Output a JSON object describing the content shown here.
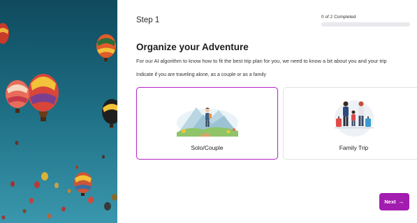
{
  "step": {
    "title": "Step 1"
  },
  "progress": {
    "text": "0 of 2 Completed",
    "fraction": 0
  },
  "content": {
    "heading": "Organize your Adventure",
    "intro": "For our AI algorithm to know how to fit the best trip plan for you, we need to know a bit about you and your trip",
    "instruction": "Indicate if you are traveling alone, as a couple or as a family"
  },
  "options": [
    {
      "label": "Solo/Couple",
      "selected": true,
      "icon": "hiker-illustration-icon"
    },
    {
      "label": "Family Trip",
      "selected": false,
      "icon": "family-travel-illustration-icon"
    }
  ],
  "actions": {
    "next_label": "Next",
    "next_icon": "arrow-right-icon"
  },
  "colors": {
    "accent": "#a21caf",
    "selected_border": "#b62ec7",
    "sky_top": "#0f4a5e",
    "sky_bottom": "#2f8ba3"
  }
}
